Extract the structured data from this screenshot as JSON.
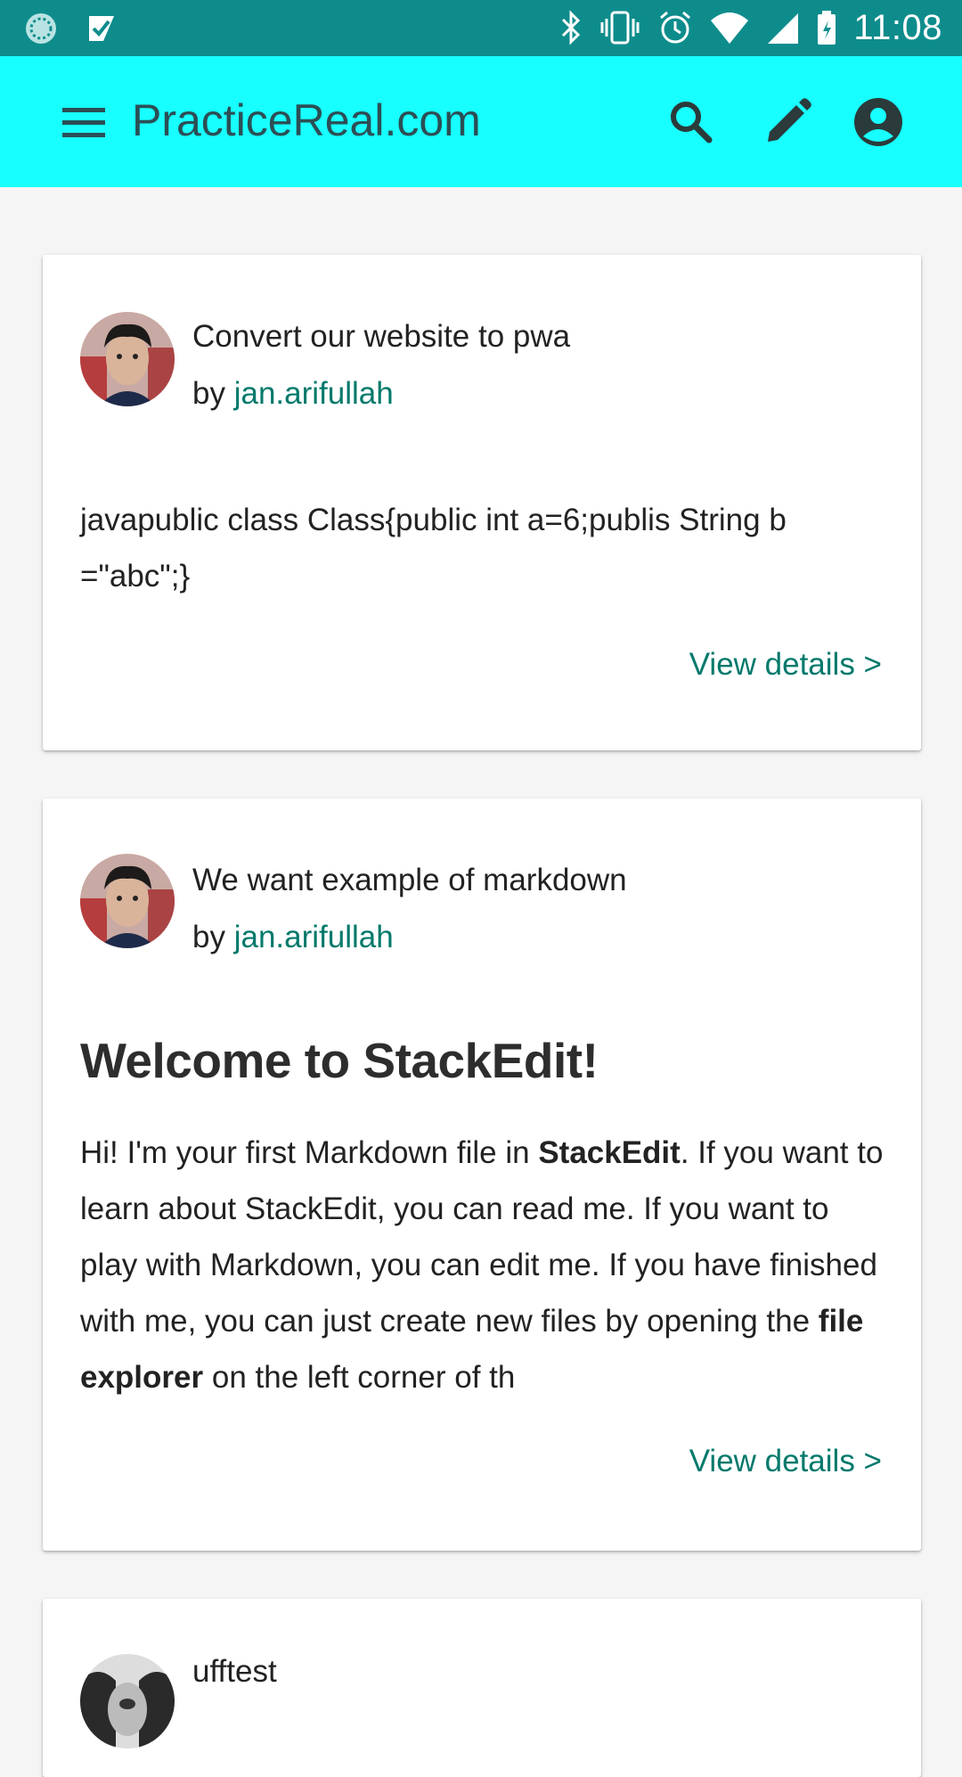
{
  "status_bar": {
    "time": "11:08",
    "left_icons": [
      "loading-spinner-icon",
      "notification-check-icon"
    ],
    "right_icons": [
      "bluetooth-icon",
      "vibrate-icon",
      "alarm-icon",
      "wifi-icon",
      "signal-icon",
      "battery-icon"
    ]
  },
  "app_bar": {
    "title": "PracticeReal.com",
    "background": "#18ffff",
    "icons": [
      "menu-icon",
      "search-icon",
      "edit-icon",
      "account-icon"
    ]
  },
  "accent_color": "#00796b",
  "posts": [
    {
      "title": "Convert our website to pwa",
      "by_prefix": "by",
      "author": "jan.arifullah",
      "body_line1": "javapublic class Class{public int a=6;publis String b",
      "body_line2": "=\"abc\";}",
      "link": "View details >"
    },
    {
      "title": "We want example of markdown",
      "by_prefix": "by",
      "author": "jan.arifullah",
      "heading": "Welcome to StackEdit!",
      "body": {
        "p1": "Hi! I'm your first Markdown file in ",
        "b1": "StackEdit",
        "p2": ". If you want to learn about StackEdit, you can read me. If you want to play with Markdown, you can edit me. If you have finished with me, you can just create new files by opening the ",
        "b2": "file explorer",
        "p3": " on the left corner of th"
      },
      "link": "View details >"
    },
    {
      "title": "ufftest"
    }
  ]
}
